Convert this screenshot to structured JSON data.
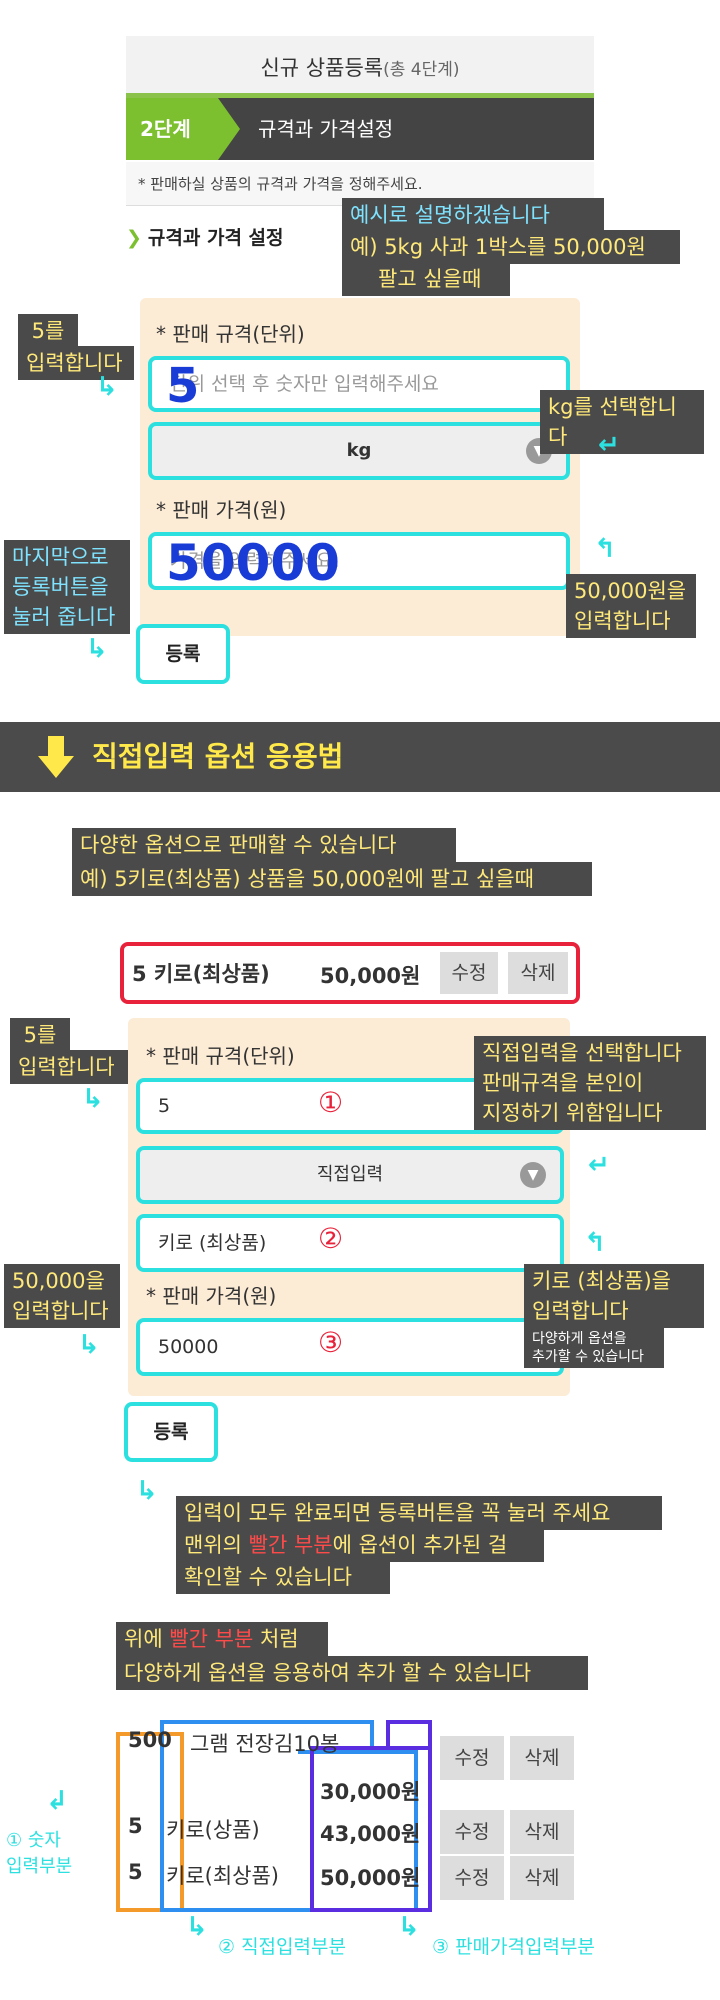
{
  "step1": {
    "card_title": "신규 상품등록",
    "card_title_sub": "(총 4단계)",
    "step_num": "2단계",
    "step_text": "규격과 가격설정",
    "description": "* 판매하실 상품의 규격과 가격을 정해주세요.",
    "section_title": "규격과 가격 설정",
    "note_example_1": "예시로 설명하겠습니다",
    "note_example_2": "예) 5kg 사과 1박스를 50,000원",
    "note_example_3": "팔고 싶을때",
    "spec_label": "* 판매 규격(단위)",
    "spec_placeholder": "단위 선택 후 숫자만 입력해주세요",
    "spec_value": "5",
    "unit_select": "kg",
    "price_label": "* 판매 가격(원)",
    "price_placeholder": "가격을 입력해주세요.",
    "price_value": "50000",
    "register_btn": "등록",
    "note_enter5_1": "5를",
    "note_enter5_2": "입력합니다",
    "note_kg": "kg를 선택합니다",
    "note_last_1": "마지막으로",
    "note_last_2": "등록버튼을",
    "note_last_3": "눌러 줍니다",
    "note_50000_1": "50,000원을",
    "note_50000_2": "입력합니다"
  },
  "banner": {
    "title": "직접입력 옵션 응용법"
  },
  "step2": {
    "note_1": "다양한 옵션으로 판매할 수 있습니다",
    "note_2": "예) 5키로(최상품) 상품을 50,000원에 팔고 싶을때",
    "opt_spec": "5 키로(최상품)",
    "opt_price": "50,000원",
    "edit_btn": "수정",
    "delete_btn": "삭제",
    "spec_label": "* 판매 규격(단위)",
    "spec_value": "5",
    "circle1": "①",
    "unit_select": "직접입력",
    "custom_value": "키로 (최상품)",
    "circle2": "②",
    "price_label": "* 판매 가격(원)",
    "price_value": "50000",
    "circle3": "③",
    "register_btn": "등록",
    "note_enter5_1": "5를",
    "note_enter5_2": "입력합니다",
    "note_direct_1": "직접입력을 선택합니다",
    "note_direct_2": "판매규격을 본인이",
    "note_direct_3": "지정하기 위함입니다",
    "note_custom_1": "키로 (최상품)을",
    "note_custom_2": "입력합니다",
    "note_custom_3": "다양하게 옵션을",
    "note_custom_4": "추가할 수 있습니다",
    "note_50000_1": "50,000을",
    "note_50000_2": "입력합니다",
    "note_done_1": "입력이 모두 완료되면 등록버튼을 꼭 눌러 주세요",
    "note_done_2a": "맨위의 ",
    "note_done_2b": "빨간 부분",
    "note_done_2c": "에 옵션이 추가된 걸",
    "note_done_3": "확인할 수 있습니다"
  },
  "step3": {
    "note_1a": "위에 ",
    "note_1b": "빨간 부분",
    "note_1c": " 처럼",
    "note_2": "다양하게 옵션을 응용하여 추가 할 수 있습니다",
    "rows": [
      {
        "num": "500",
        "unit": "그램 전장김10봉",
        "price": "30,000원"
      },
      {
        "num": "5",
        "unit": "키로(상품)",
        "price": "43,000원"
      },
      {
        "num": "5",
        "unit": "키로(최상품)",
        "price": "50,000원"
      }
    ],
    "edit_btn": "수정",
    "delete_btn": "삭제",
    "legend_1a": "① 숫자",
    "legend_1b": "입력부분",
    "legend_2": "② 직접입력부분",
    "legend_3": "③ 판매가격입력부분"
  },
  "colors": {
    "accent_green": "#7cbf2f",
    "highlight_cyan": "#2de0e0",
    "option_red": "#e8223a",
    "form_bg": "#fcebd5",
    "note_bg": "#4a4a4a",
    "legend_orange": "#f39a2a",
    "legend_blue": "#2f8ff0",
    "legend_purple": "#5a2ee0"
  }
}
